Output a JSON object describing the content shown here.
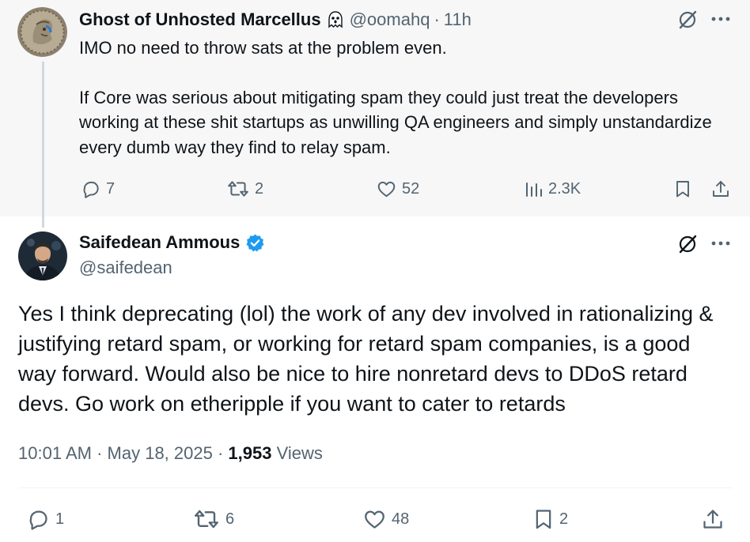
{
  "parent_tweet": {
    "display_name": "Ghost of Unhosted Marcellus",
    "name_emoji": "ghost-emoji",
    "handle": "@oomahq",
    "separator": "·",
    "time": "11h",
    "text_lines": [
      "IMO no need to throw sats at the problem even.",
      "If Core was serious about mitigating spam they could just treat the developers working at these shit startups as unwilling QA engineers and simply unstandardize every dumb way they find to relay spam."
    ],
    "replies": "7",
    "reposts": "2",
    "likes": "52",
    "views": "2.3K"
  },
  "main_tweet": {
    "display_name": "Saifedean Ammous",
    "handle": "@saifedean",
    "verified_color": "#1d9bf0",
    "text": "Yes I think deprecating (lol) the work of any dev involved in rationalizing & justifying retard spam, or working for retard spam companies, is a good way forward. Would also be nice to hire nonretard devs to DDoS retard devs. Go work on etheripple if you want to cater to retards",
    "time": "10:01 AM",
    "date": "May 18, 2025",
    "separator": "·",
    "views_count": "1,953",
    "views_label": "Views",
    "replies": "1",
    "reposts": "6",
    "likes": "48",
    "bookmarks": "2"
  },
  "colors": {
    "text_primary": "#0f1419",
    "text_secondary": "#536471",
    "parent_background": "#f7f7f7",
    "thread_line": "#cfd9de"
  }
}
